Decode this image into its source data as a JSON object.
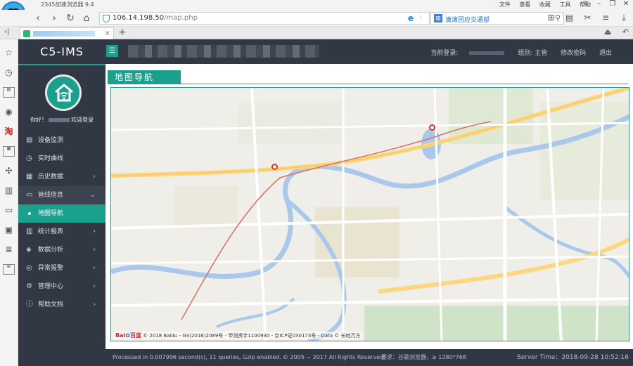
{
  "browser": {
    "title": "2345加速浏览器 9.4",
    "menus": [
      "文件",
      "查看",
      "收藏",
      "工具",
      "帮助"
    ],
    "url_host": "106.14.198.50",
    "url_path": "/map.php",
    "search_text": "滴滴回应交通部",
    "compat_sep": "⁝",
    "tab_close": "×"
  },
  "app": {
    "brand": "C5-IMS",
    "header_links": {
      "current_login": "当前登录:",
      "group": "组别: 主管",
      "change_password": "修改密码",
      "logout": "退出"
    },
    "greeting_prefix": "你好！",
    "greeting_suffix": "欢迎登录"
  },
  "sidebar": {
    "items": [
      {
        "label": "设备监测",
        "icon": "▤",
        "arrow": ""
      },
      {
        "label": "实时曲线",
        "icon": "◷",
        "arrow": ""
      },
      {
        "label": "历史数据",
        "icon": "▦",
        "arrow": "›"
      },
      {
        "label": "管线信息",
        "icon": "▭",
        "arrow": "⌄"
      },
      {
        "label": "地图导航",
        "icon": "",
        "arrow": ""
      },
      {
        "label": "统计报表",
        "icon": "▥",
        "arrow": "›"
      },
      {
        "label": "数据分析",
        "icon": "◈",
        "arrow": "›"
      },
      {
        "label": "异常报警",
        "icon": "◎",
        "arrow": "›"
      },
      {
        "label": "管理中心",
        "icon": "⚙",
        "arrow": "›"
      },
      {
        "label": "帮助文档",
        "icon": "ⓘ",
        "arrow": "›"
      }
    ]
  },
  "content": {
    "title": "地图导航",
    "map_copyright_prefix": "Bai",
    "map_copyright_logo": "百度",
    "map_copyright": "© 2018 Baidu - GS(2016)2089号 - 甲测资字1100930 - 京ICP证030173号 - Data © 长地万方"
  },
  "footer": {
    "processed": "Processed in 0.007996 second(s), 11 queries, Gzip enabled.",
    "copyright": "© 2005 ~ 2017 All Rights Reserved.",
    "requirement": "要求：谷歌浏览器，≥ 1280*768",
    "server_time": "Server Time：2018-09-28 10:52:16"
  },
  "colors": {
    "accent": "#1aa18e",
    "dark": "#313844"
  }
}
